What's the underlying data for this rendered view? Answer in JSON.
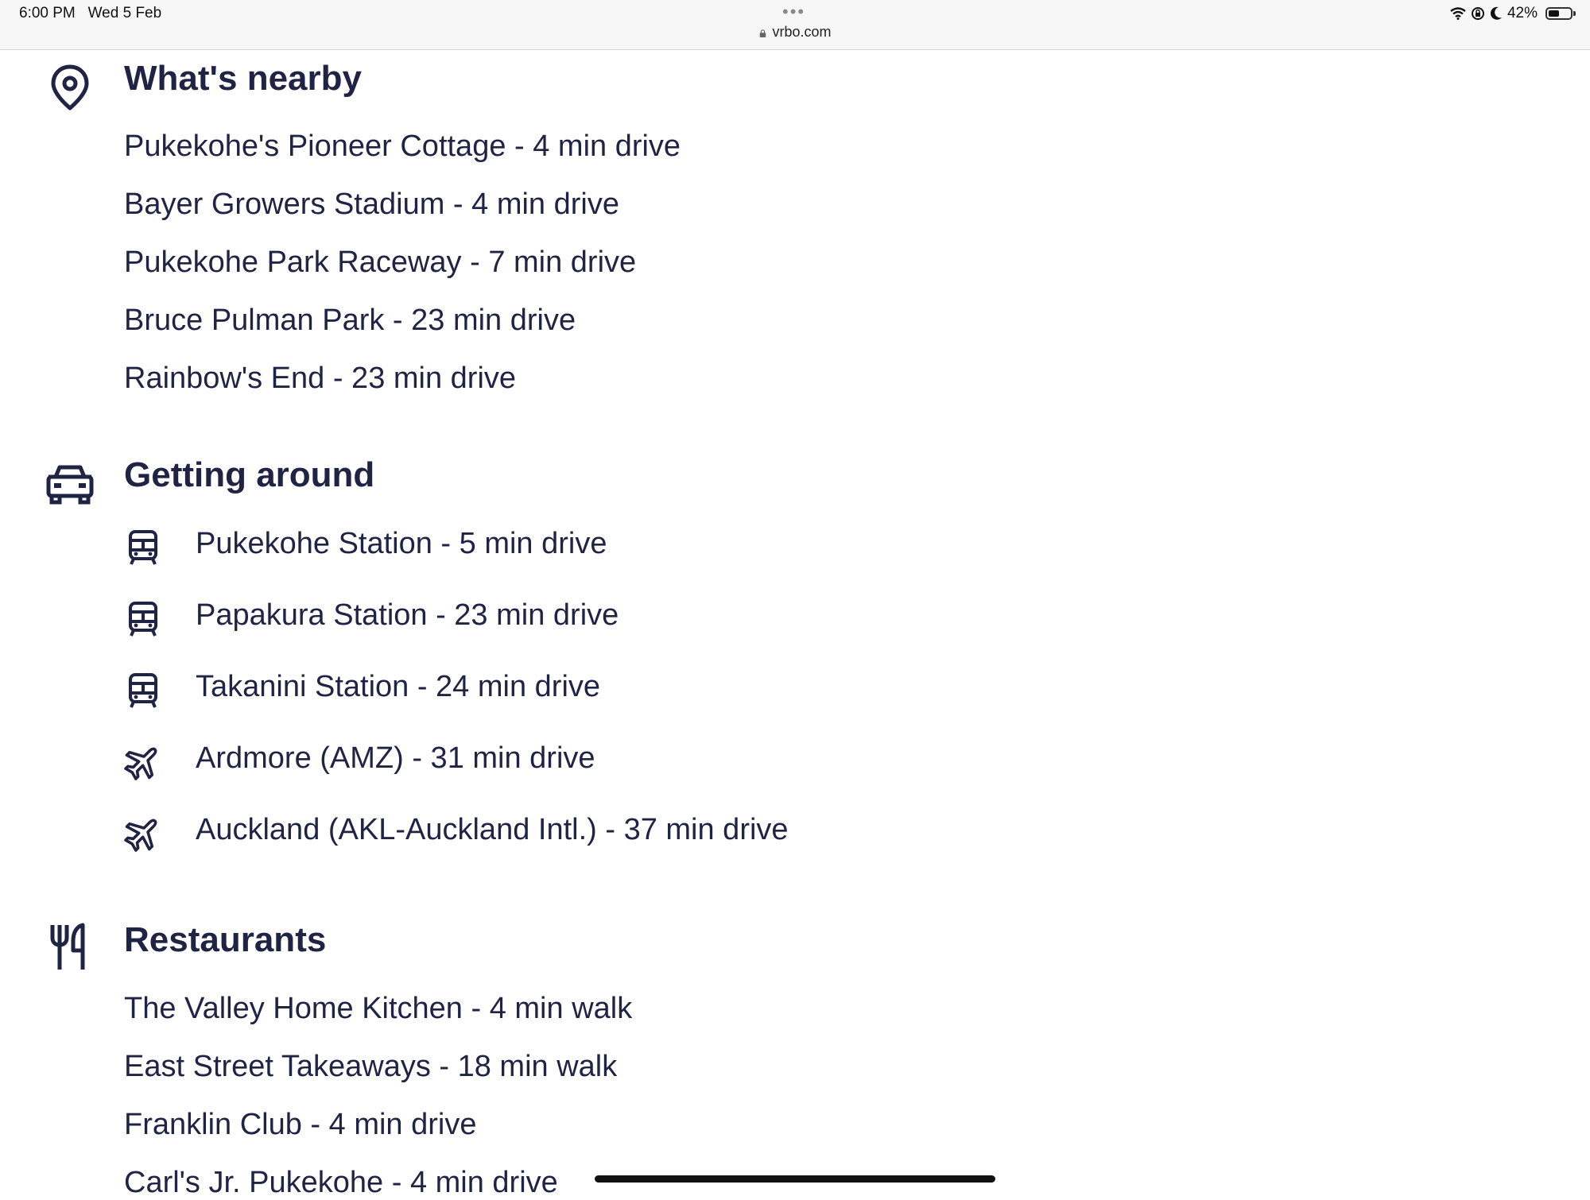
{
  "status_bar": {
    "time": "6:00 PM   Wed 5 Feb",
    "dots": "•••",
    "url": "vrbo.com",
    "battery": "42%",
    "battery_level": 0.42
  },
  "sections": {
    "nearby": {
      "title": "What's nearby",
      "icon": "location-pin-icon",
      "items": [
        "Pukekohe's Pioneer Cottage - 4 min drive",
        "Bayer Growers Stadium - 4 min drive",
        "Pukekohe Park Raceway - 7 min drive",
        "Bruce Pulman Park - 23 min drive",
        "Rainbow's End - 23 min drive"
      ]
    },
    "getting_around": {
      "title": "Getting around",
      "icon": "car-icon",
      "items": [
        {
          "icon": "train-icon",
          "text": "Pukekohe Station - 5 min drive"
        },
        {
          "icon": "train-icon",
          "text": "Papakura Station - 23 min drive"
        },
        {
          "icon": "train-icon",
          "text": "Takanini Station - 24 min drive"
        },
        {
          "icon": "airplane-icon",
          "text": "Ardmore (AMZ) - 31 min drive"
        },
        {
          "icon": "airplane-icon",
          "text": "Auckland (AKL-Auckland Intl.) - 37 min drive"
        }
      ]
    },
    "restaurants": {
      "title": "Restaurants",
      "icon": "fork-knife-icon",
      "items": [
        "The Valley Home Kitchen - 4 min walk",
        "East Street Takeaways - 18 min walk",
        "Franklin Club - 4 min drive",
        "Carl's Jr. Pukekohe - 4 min drive"
      ]
    }
  }
}
